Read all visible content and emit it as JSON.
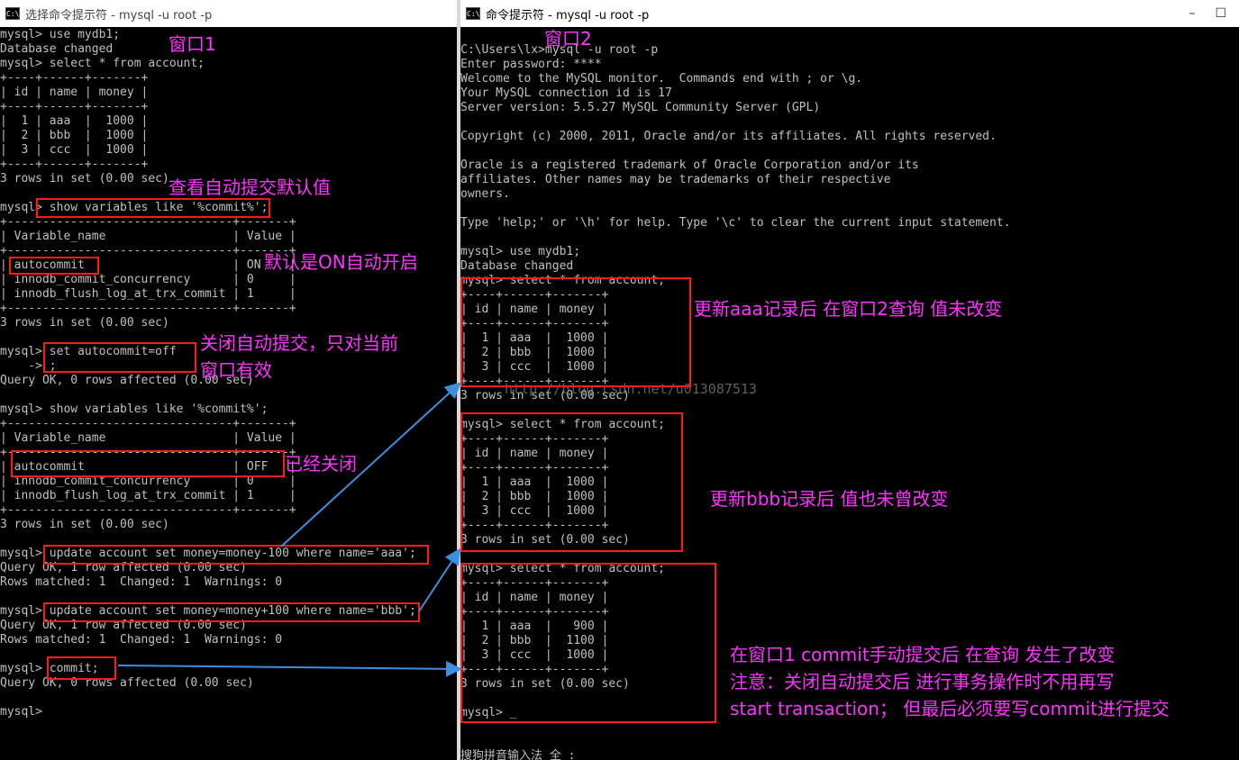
{
  "window1": {
    "title": "选择命令提示符 - mysql  -u root -p",
    "label": "窗口1",
    "lines": [
      "mysql> use mydb1;",
      "Database changed",
      "mysql> select * from account;",
      "+----+------+-------+",
      "| id | name | money |",
      "+----+------+-------+",
      "|  1 | aaa  |  1000 |",
      "|  2 | bbb  |  1000 |",
      "|  3 | ccc  |  1000 |",
      "+----+------+-------+",
      "3 rows in set (0.00 sec)",
      "",
      "mysql> show variables like '%commit%';",
      "+--------------------------------+-------+",
      "| Variable_name                  | Value |",
      "+--------------------------------+-------+",
      "| autocommit                     | ON    |",
      "| innodb_commit_concurrency      | 0     |",
      "| innodb_flush_log_at_trx_commit | 1     |",
      "+--------------------------------+-------+",
      "3 rows in set (0.00 sec)",
      "",
      "mysql> set autocommit=off",
      "    -> ;",
      "Query OK, 0 rows affected (0.00 sec)",
      "",
      "mysql> show variables like '%commit%';",
      "+--------------------------------+-------+",
      "| Variable_name                  | Value |",
      "+--------------------------------+-------+",
      "| autocommit                     | OFF   |",
      "| innodb_commit_concurrency      | 0     |",
      "| innodb_flush_log_at_trx_commit | 1     |",
      "+--------------------------------+-------+",
      "3 rows in set (0.00 sec)",
      "",
      "mysql> update account set money=money-100 where name='aaa';",
      "Query OK, 1 row affected (0.00 sec)",
      "Rows matched: 1  Changed: 1  Warnings: 0",
      "",
      "mysql> update account set money=money+100 where name='bbb';",
      "Query OK, 1 row affected (0.00 sec)",
      "Rows matched: 1  Changed: 1  Warnings: 0",
      "",
      "mysql> commit;",
      "Query OK, 0 rows affected (0.00 sec)",
      "",
      "mysql>"
    ]
  },
  "window2": {
    "title": "命令提示符 - mysql  -u root -p",
    "label": "窗口2",
    "lines": [
      "C:\\Users\\lx>mysql -u root -p",
      "Enter password: ****",
      "Welcome to the MySQL monitor.  Commands end with ; or \\g.",
      "Your MySQL connection id is 17",
      "Server version: 5.5.27 MySQL Community Server (GPL)",
      "",
      "Copyright (c) 2000, 2011, Oracle and/or its affiliates. All rights reserved.",
      "",
      "Oracle is a registered trademark of Oracle Corporation and/or its",
      "affiliates. Other names may be trademarks of their respective",
      "owners.",
      "",
      "Type 'help;' or '\\h' for help. Type '\\c' to clear the current input statement.",
      "",
      "mysql> use mydb1;",
      "Database changed",
      "mysql> select * from account;",
      "+----+------+-------+",
      "| id | name | money |",
      "+----+------+-------+",
      "|  1 | aaa  |  1000 |",
      "|  2 | bbb  |  1000 |",
      "|  3 | ccc  |  1000 |",
      "+----+------+-------+",
      "3 rows in set (0.00 sec)",
      "",
      "mysql> select * from account;",
      "+----+------+-------+",
      "| id | name | money |",
      "+----+------+-------+",
      "|  1 | aaa  |  1000 |",
      "|  2 | bbb  |  1000 |",
      "|  3 | ccc  |  1000 |",
      "+----+------+-------+",
      "3 rows in set (0.00 sec)",
      "",
      "mysql> select * from account;",
      "+----+------+-------+",
      "| id | name | money |",
      "+----+------+-------+",
      "|  1 | aaa  |   900 |",
      "|  2 | bbb  |  1100 |",
      "|  3 | ccc  |  1000 |",
      "+----+------+-------+",
      "3 rows in set (0.00 sec)",
      "",
      "mysql> _",
      "",
      "",
      "搜狗拼音输入法 全 :"
    ]
  },
  "annotations": {
    "check_default": "查看自动提交默认值",
    "default_on": "默认是ON自动开启",
    "close_autocommit_1": "关闭自动提交，只对当前",
    "close_autocommit_2": "窗口有效",
    "already_closed": "已经关闭",
    "after_aaa": "更新aaa记录后 在窗口2查询  值未改变",
    "after_bbb": "更新bbb记录后 值也未曾改变",
    "after_commit_1": "在窗口1 commit手动提交后  在查询 发生了改变",
    "after_commit_2": "注意：关闭自动提交后 进行事务操作时不用再写",
    "after_commit_3": "start transaction；  但最后必须要写commit进行提交"
  },
  "watermark": "http://blog.csdn.net/u013087513",
  "colors": {
    "annotation": "#ff33ff",
    "highlight_box": "#ff1a1a",
    "arrow": "#3d8fe0",
    "terminal_text": "#c0c0c0"
  }
}
